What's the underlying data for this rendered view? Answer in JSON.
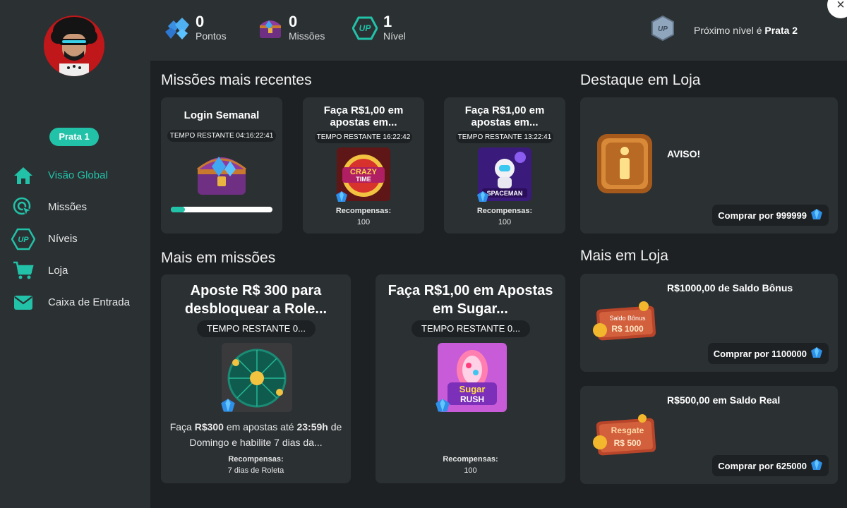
{
  "sidebar": {
    "rank": "Prata 1",
    "items": [
      {
        "label": "Visão Global"
      },
      {
        "label": "Missões"
      },
      {
        "label": "Níveis"
      },
      {
        "label": "Loja"
      },
      {
        "label": "Caixa de Entrada"
      }
    ]
  },
  "topbar": {
    "points": {
      "value": "0",
      "label": "Pontos"
    },
    "missions": {
      "value": "0",
      "label": "Missões"
    },
    "level": {
      "value": "1",
      "label": "Nível"
    },
    "next_level_prefix": "Próximo nível é",
    "next_level_name": "Prata 2",
    "close": "×"
  },
  "recent": {
    "title": "Missões mais recentes",
    "cards": [
      {
        "title": "Login Semanal",
        "timer": "TEMPO RESTANTE 04:16:22:41",
        "progress": 0.14
      },
      {
        "title": "Faça R$1,00 em apostas em...",
        "timer": "TEMPO RESTANTE 16:22:42",
        "rewards_label": "Recompensas:",
        "rewards_value": "100",
        "game": "CRAZY TIME"
      },
      {
        "title": "Faça R$1,00 em apostas em...",
        "timer": "TEMPO RESTANTE 13:22:41",
        "rewards_label": "Recompensas:",
        "rewards_value": "100",
        "game": "SPACEMAN"
      }
    ]
  },
  "more_missions": {
    "title": "Mais em missões",
    "cards": [
      {
        "title": "Aposte R$ 300 para desbloquear a Role...",
        "timer": "TEMPO RESTANTE 0...",
        "desc_pre": "Faça",
        "desc_amount": "R$300",
        "desc_mid": "em apostas até",
        "desc_time": "23:59h",
        "desc_post": "de Domingo e habilite 7 dias da...",
        "rewards_label": "Recompensas:",
        "rewards_value": "7 dias de Roleta"
      },
      {
        "title": "Faça R$1,00 em Apostas em Sugar...",
        "timer": "TEMPO RESTANTE 0...",
        "rewards_label": "Recompensas:",
        "rewards_value": "100",
        "game": "Sugar RUSH"
      }
    ]
  },
  "featured": {
    "title": "Destaque em Loja",
    "item_title": "AVISO!",
    "buy_label": "Comprar por 999999"
  },
  "more_shop": {
    "title": "Mais em Loja",
    "items": [
      {
        "title": "R$1000,00 de Saldo Bônus",
        "badge_top": "Saldo Bônus",
        "badge_bottom": "R$ 1000",
        "buy_label": "Comprar por 1100000"
      },
      {
        "title": "R$500,00 em Saldo Real",
        "badge_top": "Resgate",
        "badge_bottom": "R$ 500",
        "buy_label": "Comprar por 625000"
      }
    ]
  },
  "colors": {
    "accent": "#22c2a8",
    "panel": "#2b3033",
    "bg": "#1d2123",
    "gem": "#2d8fe8"
  }
}
